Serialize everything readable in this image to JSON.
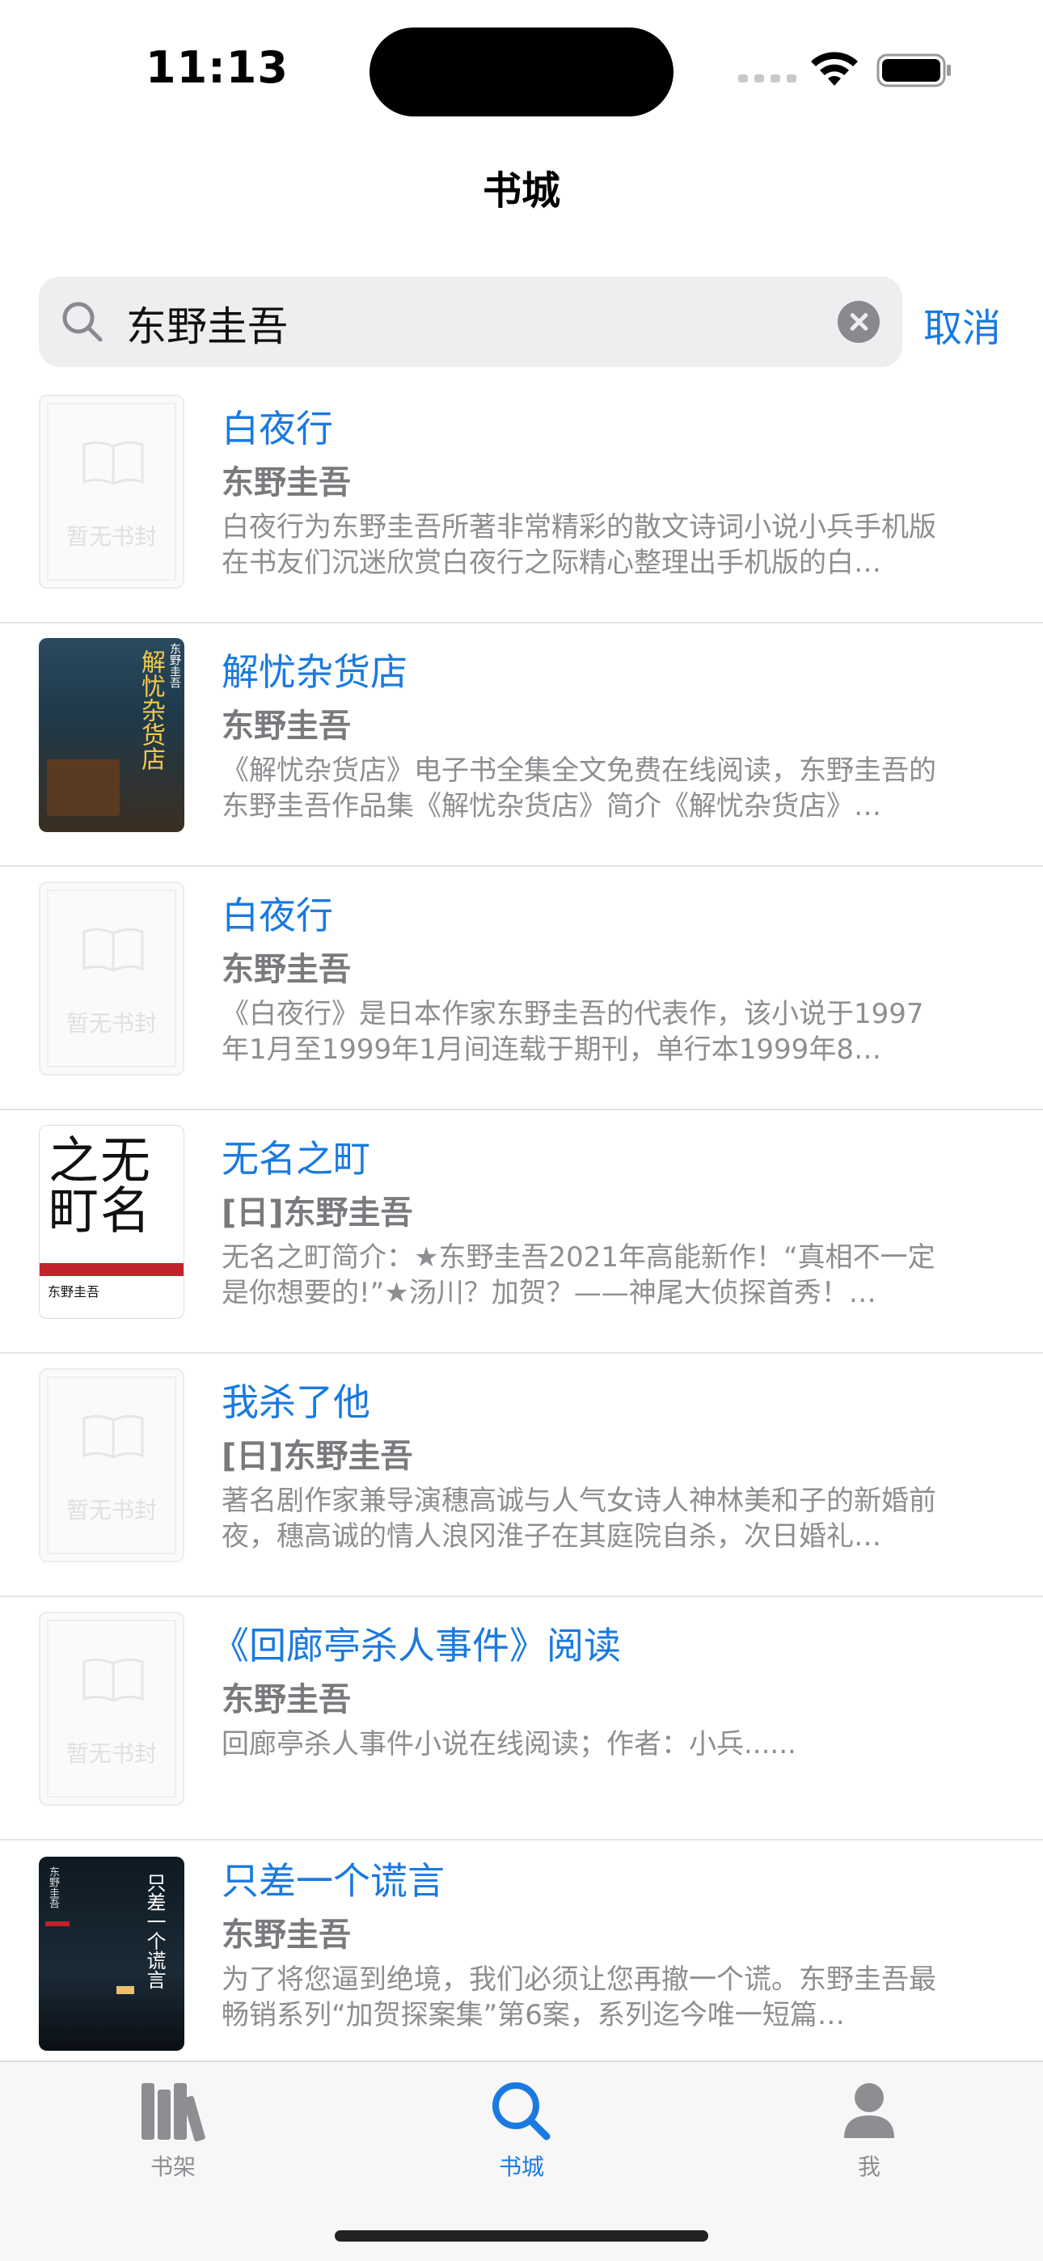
{
  "status_bar": {
    "time": "11:13"
  },
  "nav": {
    "title": "书城"
  },
  "search": {
    "query": "东野圭吾",
    "cancel_label": "取消"
  },
  "placeholder_cover_text": "暂无书封",
  "books": [
    {
      "title": "白夜行",
      "author": "东野圭吾",
      "description": "白夜行为东野圭吾所著非常精彩的散文诗词小说小兵手机版在书友们沉迷欣赏白夜行之际精心整理出手机版的白…",
      "cover": "placeholder"
    },
    {
      "title": "解忧杂货店",
      "author": "东野圭吾",
      "description": "《解忧杂货店》电子书全集全文免费在线阅读，东野圭吾的东野圭吾作品集《解忧杂货店》简介《解忧杂货店》…",
      "cover": "jieyou",
      "cover_title": "解忧杂货店",
      "cover_author": "东野圭吾"
    },
    {
      "title": "白夜行",
      "author": "东野圭吾",
      "description": "《白夜行》是日本作家东野圭吾的代表作，该小说于1997年1月至1999年1月间连载于期刊，单行本1999年8…",
      "cover": "placeholder"
    },
    {
      "title": "无名之町",
      "author": "[日]东野圭吾",
      "description": "无名之町简介：★东野圭吾2021年高能新作！“真相不一定是你想要的!”★汤川？加贺？——神尾大侦探首秀！…",
      "cover": "wuming",
      "cover_title": "无名之町",
      "cover_author": "东野圭吾"
    },
    {
      "title": "我杀了他",
      "author": "[日]东野圭吾",
      "description": "著名剧作家兼导演穗高诚与人气女诗人神林美和子的新婚前夜，穗高诚的情人浪冈淮子在其庭院自杀，次日婚礼…",
      "cover": "placeholder"
    },
    {
      "title": "《回廊亭杀人事件》阅读",
      "author": "东野圭吾",
      "description": "回廊亭杀人事件小说在线阅读；作者：小兵......",
      "cover": "placeholder"
    },
    {
      "title": "只差一个谎言",
      "author": "东野圭吾",
      "description": "为了将您逼到绝境，我们必须让您再撤一个谎。东野圭吾最畅销系列“加贺探案集”第6案，系列迄今唯一短篇…",
      "cover": "zhicha",
      "cover_title": "只差一个谎言",
      "cover_author": "东野圭吾"
    }
  ],
  "tab_bar": {
    "tabs": [
      {
        "label": "书架",
        "icon": "bookshelf-icon",
        "active": false
      },
      {
        "label": "书城",
        "icon": "search-icon",
        "active": true
      },
      {
        "label": "我",
        "icon": "person-icon",
        "active": false
      }
    ]
  },
  "colors": {
    "accent": "#1a7ae0",
    "secondary_text": "#8e8e92"
  }
}
